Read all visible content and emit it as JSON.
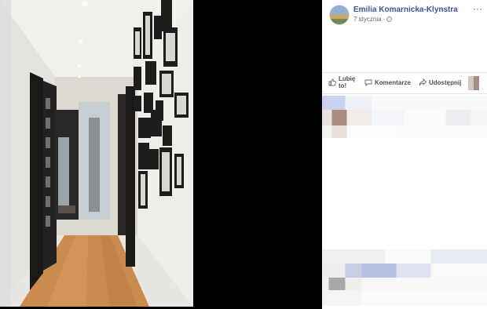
{
  "post": {
    "author": "Emilia Komarnicka-Klynstra",
    "timestamp": "7 stycznia",
    "separator": "·",
    "privacy_icon": "globe-icon",
    "more_icon": "more-icon"
  },
  "actions": {
    "like_line1": "Lubię",
    "like_line2": "to!",
    "comment": "Komentarze",
    "share": "Udostępnij"
  },
  "colors": {
    "link": "#385898",
    "meta": "#616770",
    "panel_bg": "#ffffff",
    "stage_bg": "#000000",
    "floor": "#c98c4e",
    "door": "#1b1a18"
  }
}
